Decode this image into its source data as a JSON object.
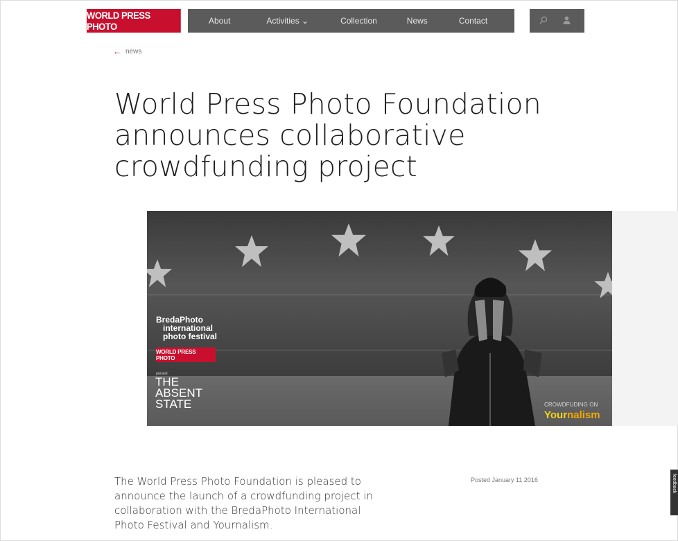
{
  "nav": {
    "logo": "WORLD PRESS PHOTO",
    "items": [
      "About",
      "Activities ⌄",
      "Collection",
      "News",
      "Contact"
    ],
    "search_icon": "search-icon",
    "user_icon": "user-icon"
  },
  "back_link": {
    "arrow": "←",
    "label": "news"
  },
  "article": {
    "title": "World Press Photo Foundation announces collaborative crowdfunding project",
    "posted": "Posted January 11 2016",
    "lead": "The World Press Photo Foundation is pleased to announce the launch of a crowdfunding project in collaboration with the BredaPhoto International Photo Festival and Yournalism."
  },
  "hero": {
    "festival_lines": [
      "BredaPhoto",
      "international",
      "photo festival"
    ],
    "badge": "WORLD PRESS PHOTO",
    "present": "present",
    "project_lines": [
      "THE",
      "ABSENT",
      "STATE"
    ],
    "crowdfunding": "CROWDFUDING ON",
    "brand_part1": "Your",
    "brand_part2": "nalism"
  },
  "side_tab": {
    "label": "feedback"
  },
  "colors": {
    "brand_red": "#c8102e",
    "nav_gray": "#5b5b5b",
    "yellow": "#f2d31b",
    "orange": "#f7a800"
  }
}
